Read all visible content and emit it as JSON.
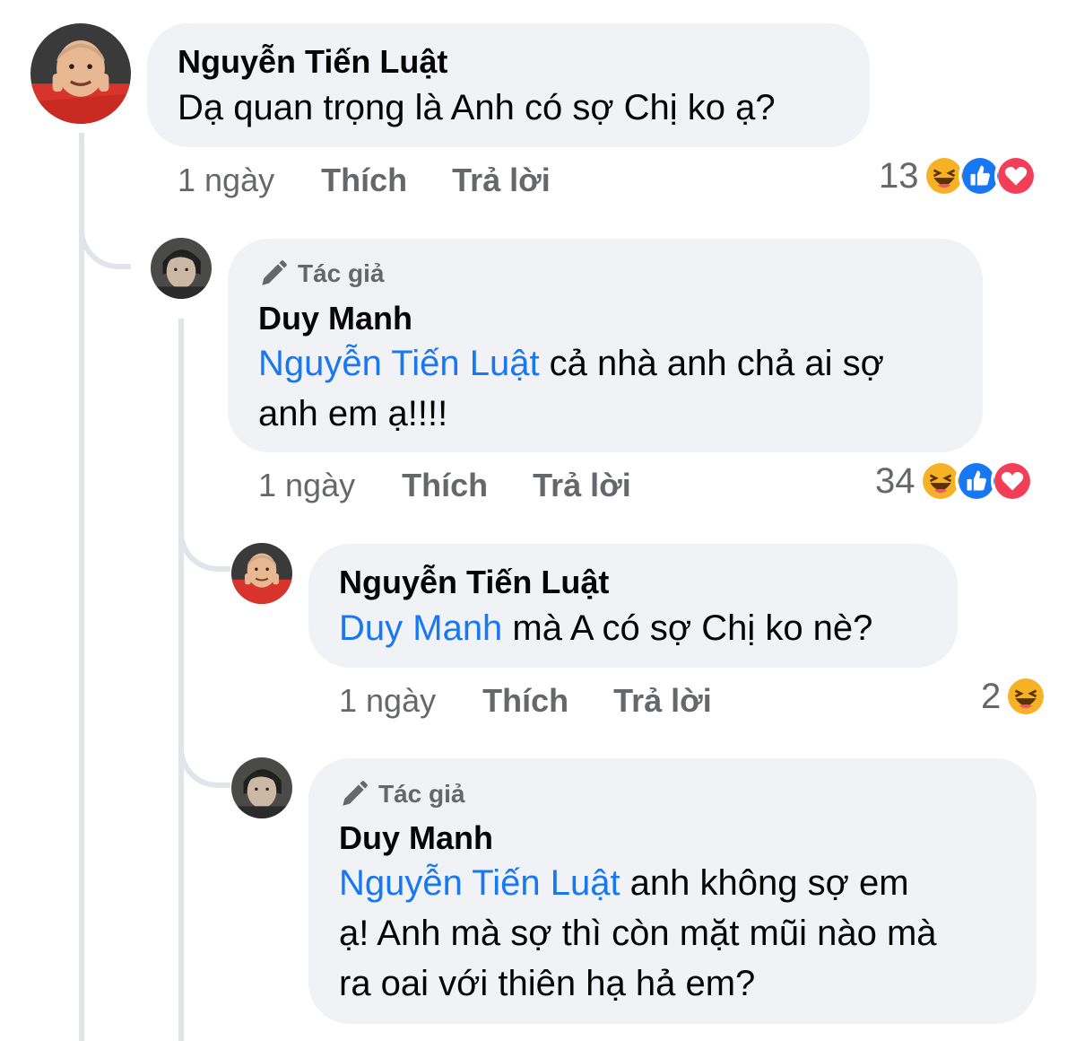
{
  "comments": [
    {
      "name": "Nguyễn Tiến Luật",
      "text": "Dạ quan trọng là Anh có sợ Chị ko ạ?",
      "time": "1 ngày",
      "like_label": "Thích",
      "reply_label": "Trả lời",
      "reaction_count": "13",
      "reactions": [
        "haha",
        "like",
        "love"
      ]
    },
    {
      "author_badge": "Tác giả",
      "name": "Duy Manh",
      "mention": "Nguyễn Tiến Luật",
      "text_line1": " cả nhà anh chả ai sợ",
      "text_line2": "anh em ạ!!!!",
      "time": "1 ngày",
      "like_label": "Thích",
      "reply_label": "Trả lời",
      "reaction_count": "34",
      "reactions": [
        "haha",
        "like",
        "love"
      ]
    },
    {
      "name": "Nguyễn Tiến Luật",
      "mention": "Duy Manh",
      "text": " mà A có sợ Chị ko nè?",
      "time": "1 ngày",
      "like_label": "Thích",
      "reply_label": "Trả lời",
      "reaction_count": "2",
      "reactions": [
        "haha"
      ]
    },
    {
      "author_badge": "Tác giả",
      "name": "Duy Manh",
      "mention": "Nguyễn Tiến Luật",
      "text_line1": " anh không sợ em",
      "text_line2": "ạ! Anh mà sợ thì còn mặt mũi nào mà",
      "text_line3": "ra oai với thiên hạ hả em?"
    }
  ],
  "colors": {
    "mention": "#1877f2",
    "bubble": "#f0f2f5",
    "meta": "#65676b",
    "like": "#1877f2",
    "love": "#f33e58",
    "haha": "#f7b125"
  }
}
